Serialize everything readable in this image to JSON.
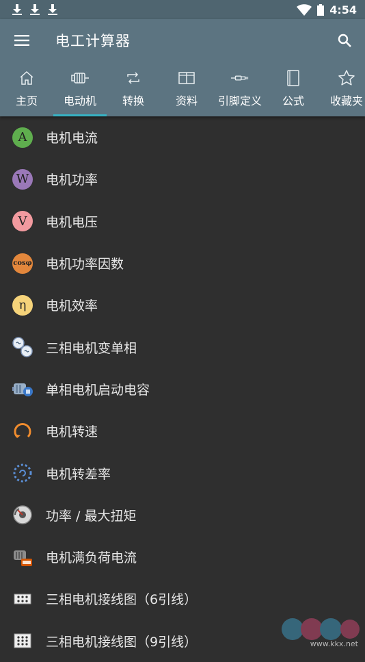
{
  "status": {
    "time": "4:54"
  },
  "app": {
    "title": "电工计算器"
  },
  "tabs": [
    {
      "label": "主页",
      "icon": "home-icon"
    },
    {
      "label": "电动机",
      "icon": "motor-icon"
    },
    {
      "label": "转换",
      "icon": "convert-icon"
    },
    {
      "label": "资料",
      "icon": "book-open-icon"
    },
    {
      "label": "引脚定义",
      "icon": "connector-icon"
    },
    {
      "label": "公式",
      "icon": "formula-book-icon"
    },
    {
      "label": "收藏夹",
      "icon": "star-icon"
    }
  ],
  "active_tab": "电动机",
  "items": [
    {
      "label": "电机电流",
      "icon": "current-a-icon",
      "glyph": "A",
      "color": "#5fae4e"
    },
    {
      "label": "电机功率",
      "icon": "power-w-icon",
      "glyph": "W",
      "color": "#9a78b8"
    },
    {
      "label": "电机电压",
      "icon": "voltage-v-icon",
      "glyph": "V",
      "color": "#f29a9f"
    },
    {
      "label": "电机功率因数",
      "icon": "cos-phi-icon",
      "glyph": "cosφ",
      "color": "#e3873c"
    },
    {
      "label": "电机效率",
      "icon": "efficiency-eta-icon",
      "glyph": "η",
      "color": "#f5d37a"
    },
    {
      "label": "三相电机变单相",
      "icon": "three-to-single-phase-icon"
    },
    {
      "label": "单相电机启动电容",
      "icon": "start-capacitor-icon"
    },
    {
      "label": "电机转速",
      "icon": "rotation-speed-icon"
    },
    {
      "label": "电机转差率",
      "icon": "slip-icon"
    },
    {
      "label": "功率 / 最大扭矩",
      "icon": "torque-icon"
    },
    {
      "label": "电机满负荷电流",
      "icon": "full-load-current-icon"
    },
    {
      "label": "三相电机接线图（6引线）",
      "icon": "wiring-6-icon"
    },
    {
      "label": "三相电机接线图（9引线）",
      "icon": "wiring-9-icon"
    }
  ],
  "watermark": {
    "text": "www.kkx.net"
  }
}
